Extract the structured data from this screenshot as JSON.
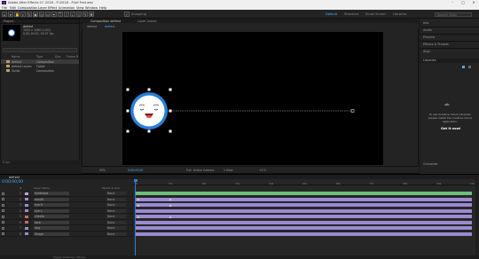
{
  "window": {
    "title": "Adobe After Effects CC 2018 - F:\\2018 - Ft\\ef Fast.aep",
    "logo": "Ae"
  },
  "menu": [
    "File",
    "Edit",
    "Composition",
    "Layer",
    "Effect",
    "Animation",
    "View",
    "Window",
    "Help"
  ],
  "toolbar": {
    "snapping_label": "Snapping",
    "workspaces": [
      "Default",
      "Standard",
      "Small Screen",
      "Libraries"
    ],
    "active_workspace": "Default",
    "search_placeholder": "Search Help"
  },
  "project": {
    "panel_title": "Project",
    "selected_name": "defrest",
    "selected_info": [
      "1920 x 1080 (1.00)",
      "0;00;10;00, 29.97 fps"
    ],
    "search_placeholder": "",
    "columns": [
      "Name",
      "Type",
      "Size",
      "Frame R"
    ],
    "items": [
      {
        "name": "defrest",
        "type": "Composition",
        "size": "",
        "color": "#b7a06a"
      },
      {
        "name": "defrest Layers",
        "type": "Folder",
        "size": "",
        "color": "#b7a06a"
      },
      {
        "name": "Solids",
        "type": "Composition",
        "size": "",
        "color": "#b7a06a"
      }
    ],
    "footer": "8 bpc"
  },
  "composition": {
    "tabs": [
      "Composition defrest",
      "Layer (none)"
    ],
    "sub_tabs": [
      "defrest",
      "defrest"
    ],
    "viewer_bar": [
      "50%",
      "0;00;00;00",
      "Full",
      "Active Camera",
      "1 View",
      "+0.0"
    ]
  },
  "right_panels": {
    "items": [
      "Info",
      "Audio",
      "Preview",
      "Effects & Presets",
      "Align"
    ],
    "libraries_title": "Libraries",
    "message": "To use Creative Cloud Libraries, please install the Creative Cloud application.",
    "button": "Get it now!",
    "bottom": "Character"
  },
  "timeline": {
    "tab": "defrest",
    "timecode": "0;00;00;00",
    "ruler_ticks": [
      "0s",
      "01s",
      "02s",
      "03s",
      "04s",
      "05s",
      "06s",
      "07s",
      "08s",
      "09s",
      "10s"
    ],
    "columns": [
      "#",
      "Layer Name",
      "Parent & Link"
    ],
    "layers": [
      {
        "index": "1",
        "name": "eyebrows",
        "parent": "None",
        "label": "#c8a0d0"
      },
      {
        "index": "2",
        "name": "mouth",
        "parent": "None",
        "label": "#9a8ad0"
      },
      {
        "index": "3",
        "name": "eye R",
        "parent": "None",
        "label": "#9a8ad0"
      },
      {
        "index": "4",
        "name": "eye L",
        "parent": "None",
        "label": "#9a8ad0"
      },
      {
        "index": "5",
        "name": "cheeks",
        "parent": "None",
        "label": "#c86a6a"
      },
      {
        "index": "6",
        "name": "face",
        "parent": "None",
        "label": "#c86a6a"
      },
      {
        "index": "7",
        "name": "ring",
        "parent": "None",
        "label": "#9a8ad0"
      },
      {
        "index": "8",
        "name": "Shape",
        "parent": "None",
        "label": "#9a8ad0"
      }
    ],
    "footer": "Toggle Switches / Modes"
  },
  "colors": {
    "accent": "#4da8ff",
    "playhead": "#2a7fd6",
    "face_ring": "#2a7fd6",
    "layer_bar": "#9a8ad0",
    "layer_bar_green": "#6bbf7a"
  }
}
